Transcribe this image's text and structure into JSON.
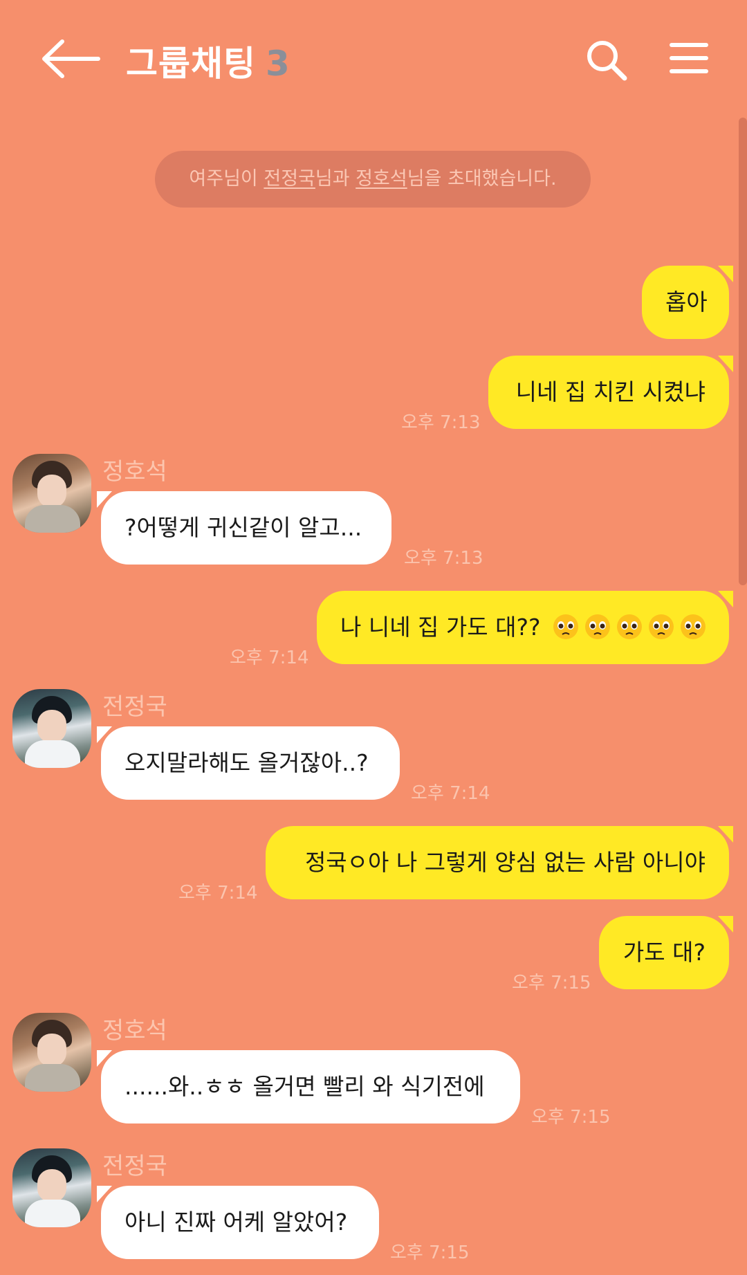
{
  "header": {
    "title": "그룹채팅",
    "member_count": "3",
    "back_icon": "arrow-left-icon",
    "search_icon": "search-icon",
    "menu_icon": "hamburger-menu-icon"
  },
  "system_message": {
    "prefix": "여주님이 ",
    "name1": "전정국",
    "mid": "님과 ",
    "name2": "정호석",
    "suffix": "님을 초대했습니다."
  },
  "messages": [
    {
      "from": "me",
      "text": "홉아",
      "time": ""
    },
    {
      "from": "me",
      "text": "니네 집 치킨 시켰냐",
      "time": "오후 7:13"
    },
    {
      "from": "정호석",
      "text": "?어떻게 귀신같이 알고...",
      "time": "오후 7:13"
    },
    {
      "from": "me",
      "text": "나 니네 집 가도 대??",
      "emoji": "pleading-face",
      "emoji_count": 5,
      "time": "오후 7:14"
    },
    {
      "from": "전정국",
      "text": "오지말라해도 올거잖아..?",
      "time": "오후 7:14"
    },
    {
      "from": "me",
      "text": "정국ㅇ아 나 그렇게 양심 없는 사람 아니야",
      "time": "오후 7:14"
    },
    {
      "from": "me",
      "text": "가도 대?",
      "time": "오후 7:15"
    },
    {
      "from": "정호석",
      "text": "......와..ㅎㅎ 올거면 빨리 와 식기전에",
      "time": "오후 7:15"
    },
    {
      "from": "전정국",
      "text": "아니 진짜 어케 알았어?",
      "time": "오후 7:15"
    }
  ],
  "colors": {
    "background": "#f68f6c",
    "my_bubble": "#ffe925",
    "other_bubble": "#ffffff",
    "count": "#8a8f99"
  }
}
